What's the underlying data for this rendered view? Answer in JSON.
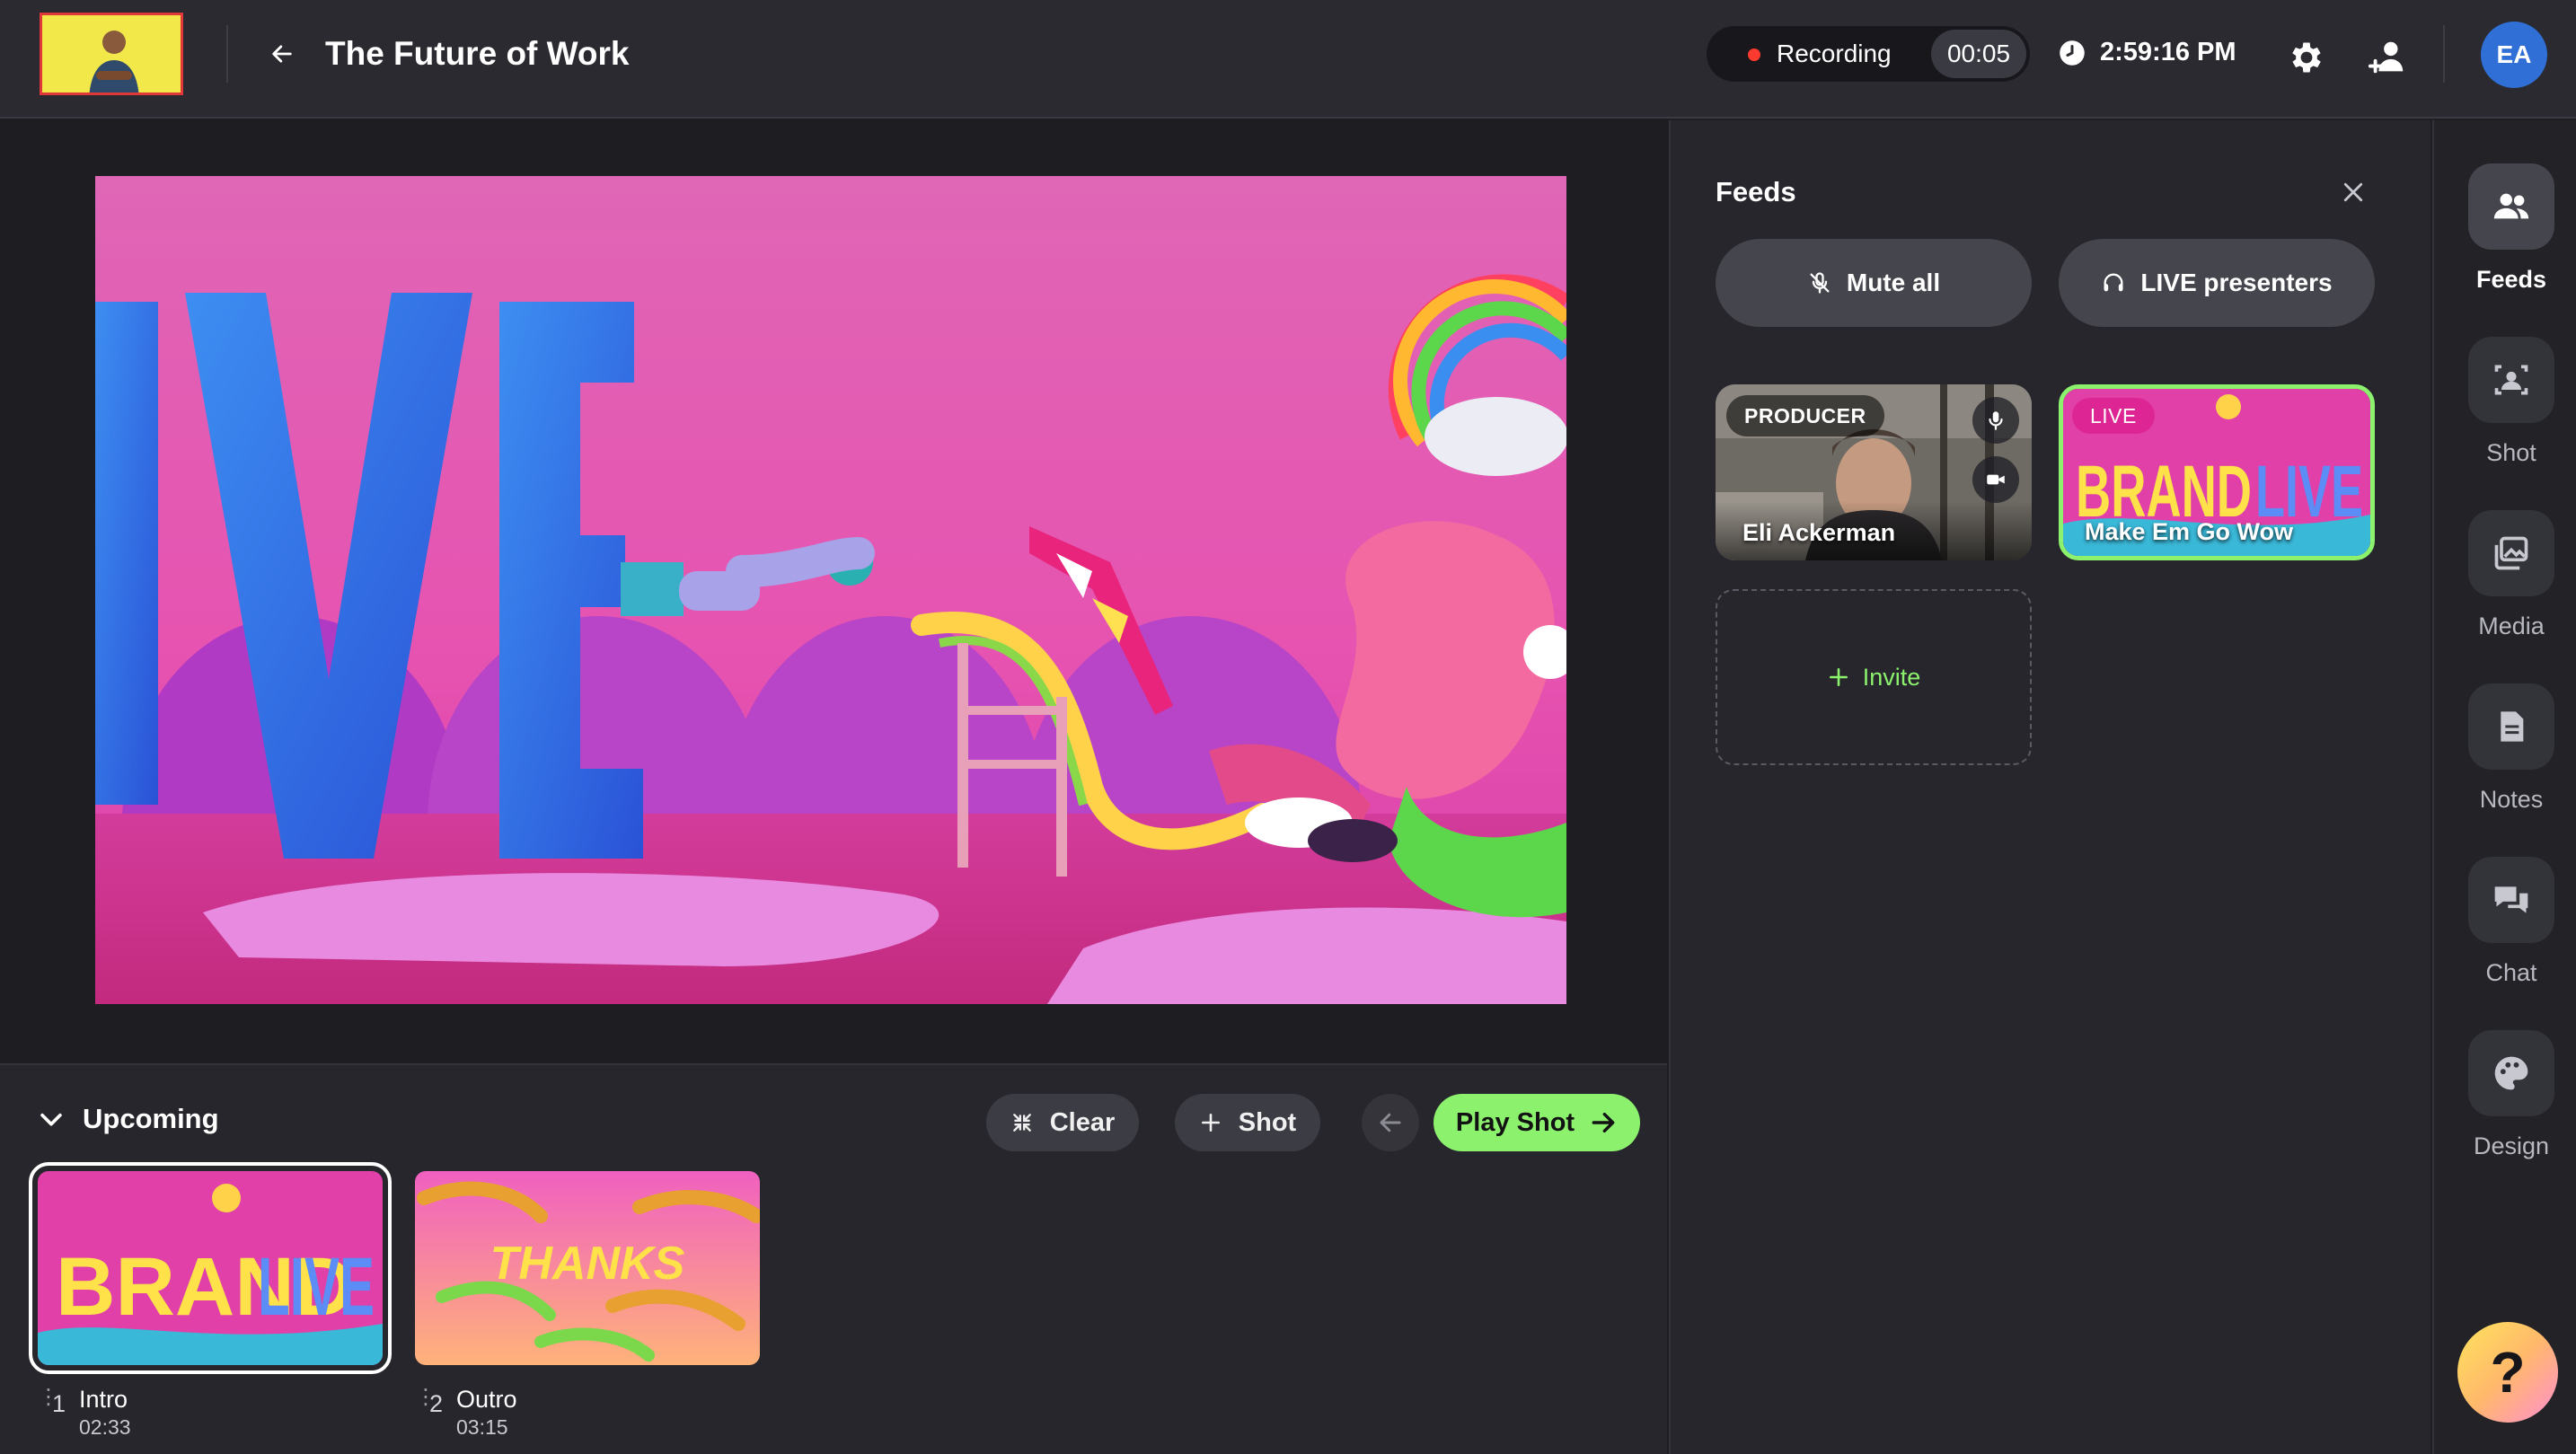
{
  "header": {
    "title": "The Future of Work",
    "recording_label": "Recording",
    "recording_time": "00:05",
    "clock": "2:59:16 PM",
    "avatar_initials": "EA"
  },
  "upcoming": {
    "title": "Upcoming",
    "clear_label": "Clear",
    "shot_label": "Shot",
    "play_label": "Play Shot",
    "shots": [
      {
        "number": "1",
        "name": "Intro",
        "duration": "02:33",
        "thumb_text_a": "BRAND",
        "thumb_text_b": "LIVE"
      },
      {
        "number": "2",
        "name": "Outro",
        "duration": "03:15",
        "thumb_text": "THANKS"
      }
    ]
  },
  "stage": {
    "scene_text": "LIVE"
  },
  "feeds": {
    "title": "Feeds",
    "mute_all_label": "Mute all",
    "live_presenters_label": "LIVE presenters",
    "tiles": [
      {
        "badge": "PRODUCER",
        "name": "Eli Ackerman"
      },
      {
        "badge": "LIVE",
        "name": "Make Em Go Wow",
        "brand_a": "BRAND",
        "brand_b": "LIVE"
      }
    ],
    "invite_label": "Invite"
  },
  "rail": {
    "items": [
      {
        "label": "Feeds",
        "icon": "people-icon"
      },
      {
        "label": "Shot",
        "icon": "shot-icon"
      },
      {
        "label": "Media",
        "icon": "media-icon"
      },
      {
        "label": "Notes",
        "icon": "notes-icon"
      },
      {
        "label": "Chat",
        "icon": "chat-icon"
      },
      {
        "label": "Design",
        "icon": "palette-icon"
      }
    ]
  },
  "help": {
    "label": "?"
  },
  "colors": {
    "accent_green": "#8cf26e",
    "recording_red": "#ff3b30",
    "avatar_blue": "#2f6fd6",
    "stage_pink": "#e050b8"
  }
}
